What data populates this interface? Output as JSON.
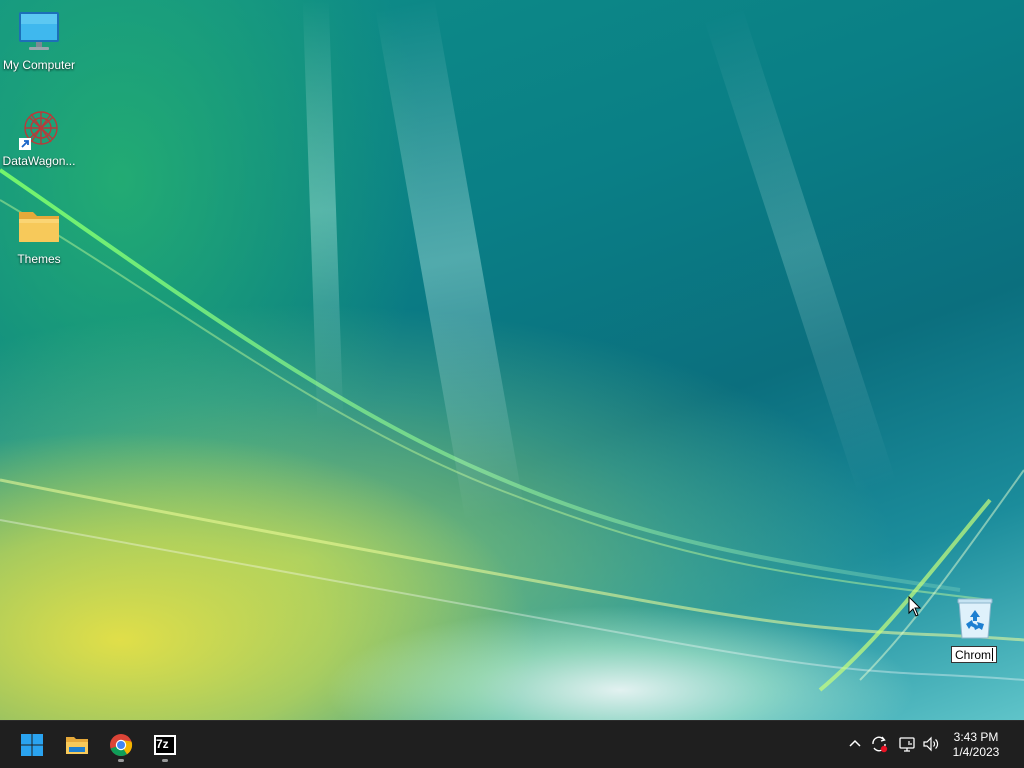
{
  "desktop": {
    "icons": [
      {
        "label": "My Computer",
        "icon": "computer-icon"
      },
      {
        "label": "DataWagon...",
        "icon": "datawagon-shortcut-icon"
      },
      {
        "label": "Themes",
        "icon": "folder-icon"
      },
      {
        "label": "",
        "icon": "recycle-bin-icon"
      }
    ],
    "rename_value": "Chrom"
  },
  "taskbar": {
    "apps": [
      {
        "name": "Start",
        "icon": "windows-start-icon"
      },
      {
        "name": "File Explorer",
        "icon": "file-explorer-icon"
      },
      {
        "name": "Google Chrome",
        "icon": "chrome-icon"
      },
      {
        "name": "7-Zip",
        "icon": "seven-zip-icon",
        "label": "7z"
      }
    ],
    "tray": {
      "icons": [
        "chevron-up-icon",
        "sync-icon",
        "network-icon",
        "volume-icon"
      ]
    },
    "clock": {
      "time": "3:43 PM",
      "date": "1/4/2023"
    }
  },
  "colors": {
    "taskbar_bg": "#1f1f1f",
    "wallpaper_teal": "#0a7f86",
    "wallpaper_yellow": "#e8e246",
    "windows_blue": "#2aa3f0"
  }
}
